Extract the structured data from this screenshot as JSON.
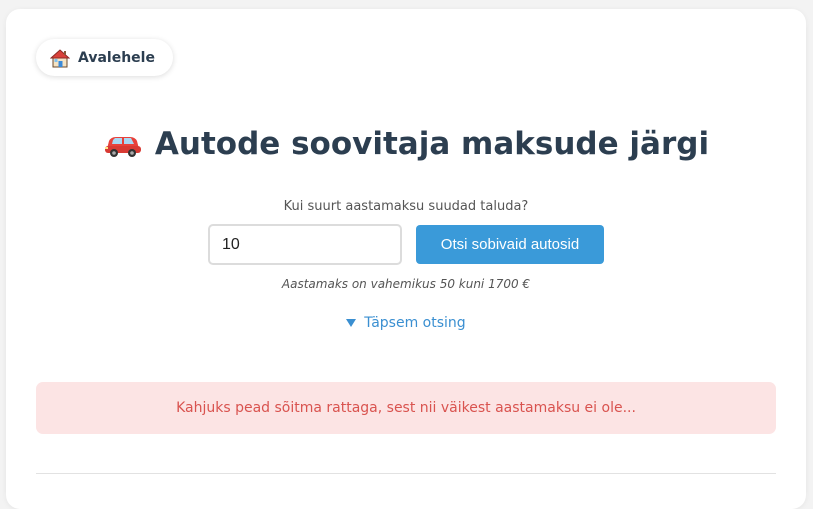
{
  "nav": {
    "home_label": "Avalehele",
    "home_icon": "house-icon"
  },
  "header": {
    "title": "Autode soovitaja maksude järgi",
    "title_icon": "car-icon"
  },
  "search": {
    "question": "Kui suurt aastamaksu suudad taluda?",
    "tax_value": "10",
    "button_label": "Otsi sobivaid autosid",
    "range_note": "Aastamaks on vahemikus 50 kuni 1700 €",
    "advanced_label": "Täpsem otsing",
    "advanced_icon": "triangle-down-icon"
  },
  "alert": {
    "message": "Kahjuks pead sõitma rattaga, sest nii väikest aastamaksu ei ole..."
  },
  "colors": {
    "accent": "#3a9ad9",
    "link": "#3a8fd1",
    "heading": "#2c3e50",
    "error_bg": "#fce4e4",
    "error_text": "#d9534f"
  }
}
